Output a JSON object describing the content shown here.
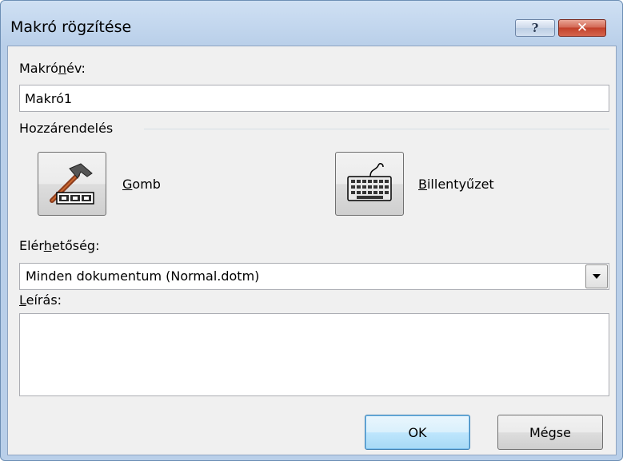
{
  "window": {
    "title": "Makró rögzítése",
    "help_glyph": "?",
    "close_glyph": "✕"
  },
  "macro_name": {
    "label_before": "Makró",
    "label_key": "n",
    "label_after": "év:",
    "value": "Makró1"
  },
  "assignment": {
    "group_label": "Hozzárendelés",
    "button_key": "G",
    "button_rest": "omb",
    "keyboard_key": "B",
    "keyboard_rest": "illentyűzet"
  },
  "availability": {
    "label_before": "Elér",
    "label_key": "h",
    "label_after": "etőség:",
    "selected": "Minden dokumentum (Normal.dotm)"
  },
  "description": {
    "label_key": "L",
    "label_rest": "eírás:",
    "value": ""
  },
  "buttons": {
    "ok": "OK",
    "cancel": "Mégse"
  },
  "icons": {
    "button_icon": "hammer-toolbar-icon",
    "keyboard_icon": "keyboard-icon",
    "dropdown_icon": "triangle-down-icon"
  },
  "colors": {
    "titlebar": "#c3d7ee",
    "close_button": "#c2412b",
    "default_button_border": "#3c7fb1"
  }
}
